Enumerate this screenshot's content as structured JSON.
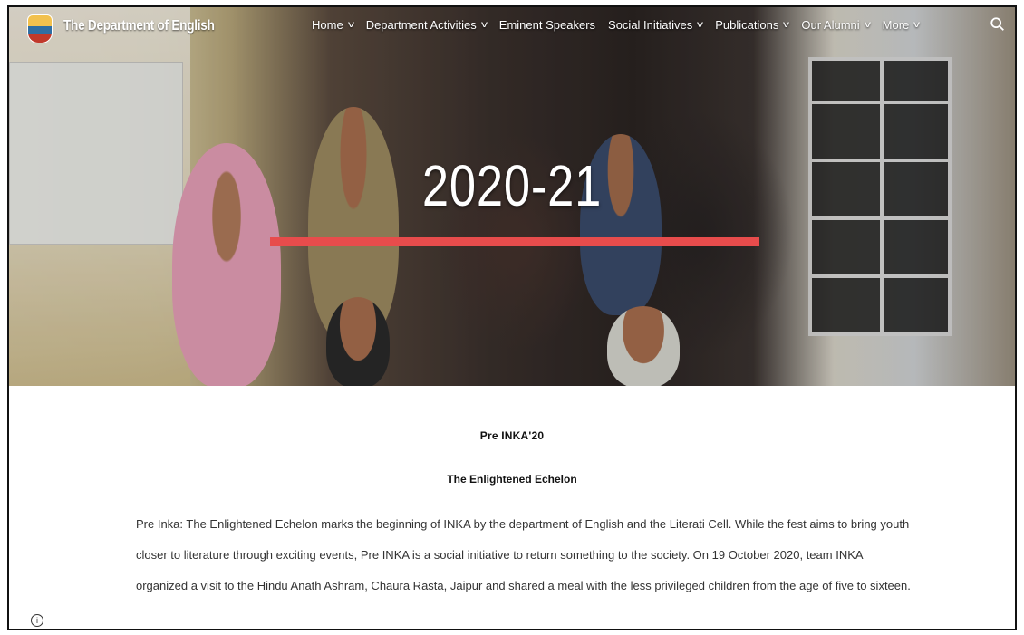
{
  "header": {
    "site_title": "The Department of English",
    "nav": [
      {
        "label": "Home",
        "has_dropdown": true
      },
      {
        "label": "Department Activities",
        "has_dropdown": true
      },
      {
        "label": "Eminent Speakers",
        "has_dropdown": false
      },
      {
        "label": "Social Initiatives",
        "has_dropdown": true
      },
      {
        "label": "Publications",
        "has_dropdown": true
      },
      {
        "label": "Our Alumni",
        "has_dropdown": true
      },
      {
        "label": "More",
        "has_dropdown": true
      }
    ],
    "dropdown_glyph": "v",
    "icons": {
      "logo": "department-crest-icon",
      "search": "search-icon"
    }
  },
  "hero": {
    "title": "2020-21",
    "accent_color": "#e74c4c"
  },
  "content": {
    "heading": "Pre INKA'20",
    "subheading": "The Enlightened Echelon",
    "paragraph": "Pre Inka: The Enlightened Echelon marks the beginning of INKA by the department of English and the Literati Cell. While the fest aims to bring youth closer to literature through exciting events, Pre INKA is a social initiative to return something to the society. On 19 October 2020, team INKA organized a visit to the Hindu Anath Ashram, Chaura Rasta, Jaipur and shared a meal with the less privileged children from the age of five to sixteen.",
    "info_icon": "info-icon"
  }
}
